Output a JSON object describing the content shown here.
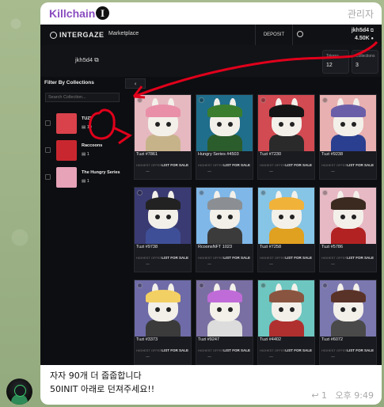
{
  "chat": {
    "sender": "Killchain",
    "sender_badge": "I",
    "role": "관리자",
    "message_line1": "자자 90개 더 줍줍합니다",
    "message_line2": "50INIT 아래로 던져주세요!!",
    "reply_count": "1",
    "time": "오후 9:49"
  },
  "app": {
    "logo": "INTERGAZE",
    "nav_marketplace": "Marketplace",
    "deposit_label": "DEPOSIT",
    "account_name": "jkh5d4",
    "account_balance": "4.50K",
    "profile_name": "jkh5d4",
    "stats": [
      {
        "label": "Tokens",
        "value": "12"
      },
      {
        "label": "Collections",
        "value": "3"
      }
    ],
    "filter_title": "Filter By Collections",
    "search_placeholder": "Search Collection...",
    "collapse_glyph": "‹",
    "collections": [
      {
        "name": "TUZI",
        "count": "10"
      },
      {
        "name": "Raccoons",
        "count": "1"
      },
      {
        "name": "The Hungry Series",
        "count": "1"
      }
    ],
    "offer_label": "HIGHEST OFFER",
    "offer_value": "—",
    "sale_label": "LIST FOR SALE",
    "cards": [
      {
        "title": "Tuzi #7861"
      },
      {
        "title": "Hungry Series #4503"
      },
      {
        "title": "Tuzi #7230"
      },
      {
        "title": "Tuzi #9238"
      },
      {
        "title": "Tuzi #9738"
      },
      {
        "title": "RcoonsNFT 1023"
      },
      {
        "title": "Tuzi #7258"
      },
      {
        "title": "Tuzi #5786"
      },
      {
        "title": "Tuzi #3373"
      },
      {
        "title": "Tuzi #9247"
      },
      {
        "title": "Tuzi #4402"
      },
      {
        "title": "Tuzi #6072"
      }
    ]
  },
  "colors": {
    "sender": "#8a4dbf",
    "annotation": "#e0001b",
    "card_backgrounds": [
      "#e6b9c0",
      "#1f6e8c",
      "#d24a52",
      "#e8b0b0",
      "#3a3b73",
      "#7fb7e8",
      "#86c5e6",
      "#e6b9c4",
      "#6e6ba8",
      "#7a6fa2",
      "#6dc6c0",
      "#7b78b0"
    ],
    "hat_colors": [
      "#e98fa8",
      "#3a7d2e",
      "#151515",
      "#6b5ea8",
      "#222222",
      "#8b8f93",
      "#f1b23a",
      "#3a2a20",
      "#f3d063",
      "#c06cd8",
      "#8a5540",
      "#5a3328"
    ],
    "body_colors": [
      "#c7b38a",
      "#2b5c2b",
      "#2a2a2a",
      "#2a3f8f",
      "#3f4f97",
      "#3b3b3b",
      "#e0a020",
      "#b22222",
      "#3b3b3b",
      "#dcdcdc",
      "#b03030",
      "#4a4a4a"
    ]
  }
}
